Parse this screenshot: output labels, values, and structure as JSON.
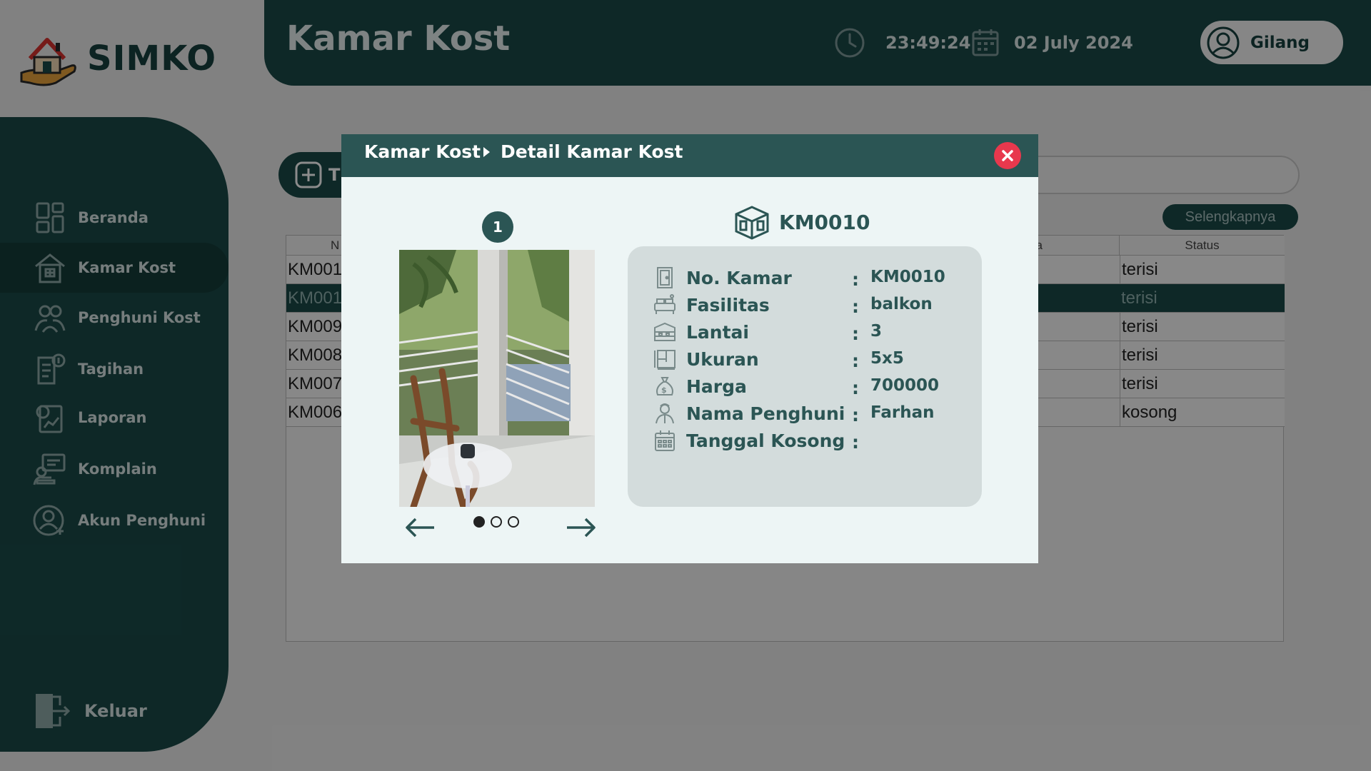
{
  "app": {
    "name": "SIMKO"
  },
  "header": {
    "title": "Kamar Kost",
    "time": "23:49:24",
    "date": "02 July 2024",
    "user": "Gilang"
  },
  "sidebar": {
    "items": [
      {
        "label": "Beranda",
        "icon": "dashboard-icon"
      },
      {
        "label": "Kamar Kost",
        "icon": "house-icon",
        "active": true
      },
      {
        "label": "Penghuni Kost",
        "icon": "users-icon"
      },
      {
        "label": "Tagihan",
        "icon": "invoice-icon"
      },
      {
        "label": "Laporan",
        "icon": "report-icon"
      },
      {
        "label": "Komplain",
        "icon": "complaint-icon"
      },
      {
        "label": "Akun Penghuni",
        "icon": "add-user-icon"
      }
    ],
    "logout": "Keluar"
  },
  "content": {
    "add_button": "T",
    "more_button": "Selengkapnya",
    "table": {
      "headers": [
        "N",
        "ga",
        "Status"
      ],
      "rows": [
        {
          "no": "KM001",
          "status": "terisi",
          "selected": false
        },
        {
          "no": "KM001",
          "status": "terisi",
          "selected": true
        },
        {
          "no": "KM009",
          "status": "terisi",
          "selected": false
        },
        {
          "no": "KM008",
          "status": "terisi",
          "selected": false
        },
        {
          "no": "KM007",
          "status": "terisi",
          "selected": false
        },
        {
          "no": "KM006",
          "status": "kosong",
          "selected": false
        }
      ]
    }
  },
  "modal": {
    "breadcrumb": [
      "Kamar Kost",
      "Detail Kamar Kost"
    ],
    "image_index": "1",
    "image_count": 3,
    "image_active": 0,
    "room_code": "KM0010",
    "details": [
      {
        "label": "No. Kamar",
        "value": "KM0010",
        "icon": "door-icon"
      },
      {
        "label": "Fasilitas",
        "value": "balkon",
        "icon": "bed-icon"
      },
      {
        "label": "Lantai",
        "value": "3",
        "icon": "building-icon"
      },
      {
        "label": "Ukuran",
        "value": "5x5",
        "icon": "floorplan-icon"
      },
      {
        "label": "Harga",
        "value": "700000",
        "icon": "money-bag-icon"
      },
      {
        "label": "Nama Penghuni",
        "value": "Farhan",
        "icon": "person-icon"
      },
      {
        "label": "Tanggal Kosong",
        "value": "",
        "icon": "calendar-icon"
      }
    ]
  },
  "colors": {
    "primary": "#1a4a48",
    "modal_header": "#2b5554",
    "close": "#e8384d",
    "card": "#d3dcdc"
  }
}
